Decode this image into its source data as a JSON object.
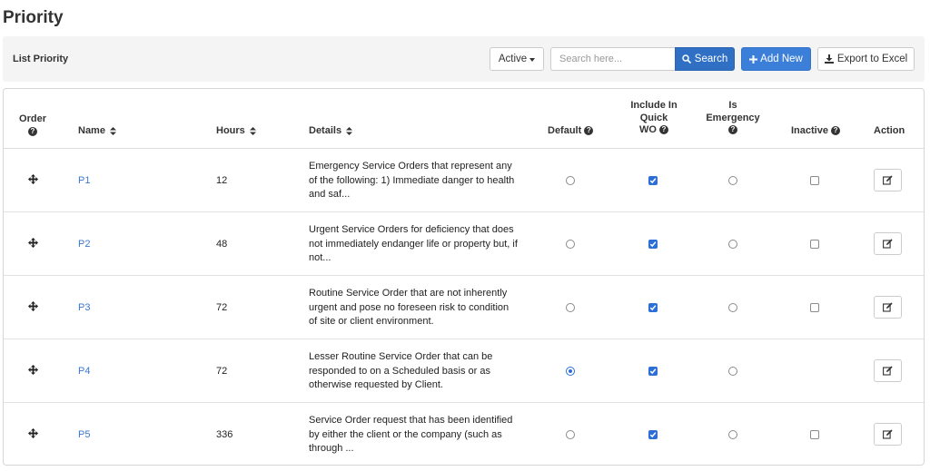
{
  "page": {
    "title": "Priority"
  },
  "toolbar": {
    "title": "List Priority",
    "status_filter": "Active",
    "search_placeholder": "Search here...",
    "search_label": "Search",
    "add_label": "Add New",
    "export_label": "Export to Excel"
  },
  "table": {
    "headers": {
      "order": "Order",
      "name": "Name",
      "hours": "Hours",
      "details": "Details",
      "default": "Default",
      "include_line1": "Include In",
      "include_line2": "Quick",
      "include_line3": "WO",
      "emergency_line1": "Is",
      "emergency_line2": "Emergency",
      "inactive": "Inactive",
      "action": "Action"
    },
    "rows": [
      {
        "name": "P1",
        "hours": "12",
        "details": "Emergency Service Orders that represent any of the following: 1) Immediate danger to health and saf...",
        "default": false,
        "include_quick_wo": true,
        "is_emergency": false,
        "inactive": false
      },
      {
        "name": "P2",
        "hours": "48",
        "details": "Urgent Service Orders for deficiency that does not immediately endanger life or property but, if not...",
        "default": false,
        "include_quick_wo": true,
        "is_emergency": false,
        "inactive": false
      },
      {
        "name": "P3",
        "hours": "72",
        "details": "Routine Service Order that are not inherently urgent and pose no foreseen risk to condition of site or client environment.",
        "default": false,
        "include_quick_wo": true,
        "is_emergency": false,
        "inactive": false
      },
      {
        "name": "P4",
        "hours": "72",
        "details": "Lesser Routine Service Order that can be responded to on a Scheduled basis or as otherwise requested by Client.",
        "default": true,
        "include_quick_wo": true,
        "is_emergency": false,
        "inactive": null
      },
      {
        "name": "P5",
        "hours": "336",
        "details": "Service Order request that has been identified by either the client or the company (such as through ...",
        "default": false,
        "include_quick_wo": true,
        "is_emergency": false,
        "inactive": false
      }
    ]
  },
  "colors": {
    "primary": "#3c7fd9",
    "link": "#3a78d4",
    "toolbar_bg": "#f4f4f4"
  }
}
